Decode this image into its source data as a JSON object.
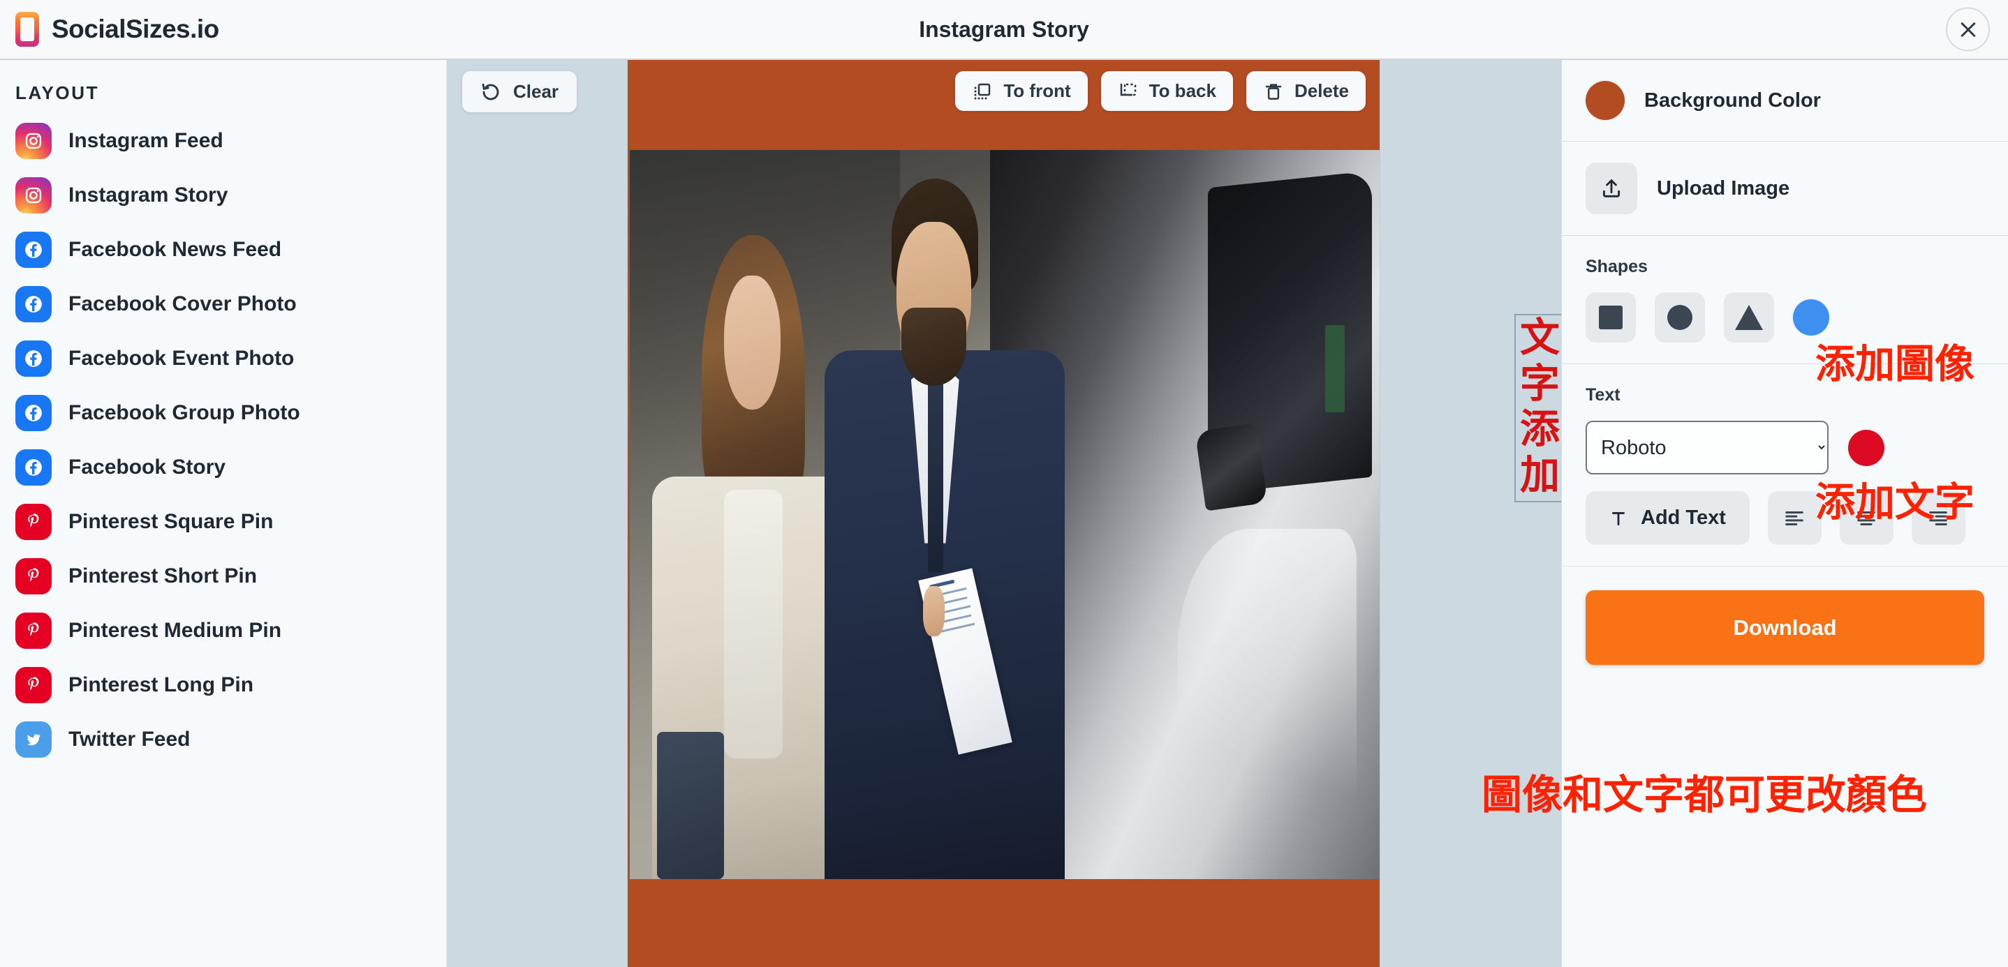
{
  "brand": {
    "name": "SocialSizes.io",
    "logo_icon": "instagram-phone-logo"
  },
  "header": {
    "title": "Instagram Story",
    "close_icon": "close-icon"
  },
  "sidebar": {
    "section_label": "LAYOUT",
    "items": [
      {
        "label": "Instagram Feed",
        "icon": "instagram-icon",
        "brand": "ig"
      },
      {
        "label": "Instagram Story",
        "icon": "instagram-icon",
        "brand": "ig"
      },
      {
        "label": "Facebook News Feed",
        "icon": "facebook-icon",
        "brand": "fb"
      },
      {
        "label": "Facebook Cover Photo",
        "icon": "facebook-icon",
        "brand": "fb"
      },
      {
        "label": "Facebook Event Photo",
        "icon": "facebook-icon",
        "brand": "fb"
      },
      {
        "label": "Facebook Group Photo",
        "icon": "facebook-icon",
        "brand": "fb"
      },
      {
        "label": "Facebook Story",
        "icon": "facebook-icon",
        "brand": "fb"
      },
      {
        "label": "Pinterest Square Pin",
        "icon": "pinterest-icon",
        "brand": "pin"
      },
      {
        "label": "Pinterest Short Pin",
        "icon": "pinterest-icon",
        "brand": "pin"
      },
      {
        "label": "Pinterest Medium Pin",
        "icon": "pinterest-icon",
        "brand": "pin"
      },
      {
        "label": "Pinterest Long Pin",
        "icon": "pinterest-icon",
        "brand": "pin"
      },
      {
        "label": "Twitter Feed",
        "icon": "twitter-icon",
        "brand": "tw"
      }
    ]
  },
  "canvas": {
    "clear_label": "Clear",
    "clear_icon": "rotate-ccw-icon",
    "to_front_label": "To front",
    "to_front_icon": "bring-to-front-icon",
    "to_back_label": "To back",
    "to_back_icon": "send-to-back-icon",
    "delete_label": "Delete",
    "delete_icon": "trash-icon",
    "background_color": "#b44c22",
    "text_object": {
      "value": "文字添加",
      "color": "#d81212",
      "selected": true
    }
  },
  "panel": {
    "background_color": {
      "label": "Background Color",
      "color": "#b44c22"
    },
    "upload": {
      "label": "Upload Image",
      "icon": "upload-icon"
    },
    "shapes": {
      "title": "Shapes",
      "items": [
        {
          "name": "square-shape",
          "icon": "square-icon"
        },
        {
          "name": "circle-shape",
          "icon": "circle-icon"
        },
        {
          "name": "triangle-shape",
          "icon": "triangle-icon"
        }
      ],
      "color": "#3d90f0"
    },
    "text": {
      "title": "Text",
      "font_value": "Roboto",
      "font_options": [
        "Roboto"
      ],
      "color": "#dd0a23",
      "add_text_label": "Add Text",
      "add_text_icon": "text-t-icon",
      "align_left_icon": "align-left-icon",
      "align_center_icon": "align-center-icon",
      "align_right_icon": "align-right-icon"
    },
    "download_label": "Download",
    "download_color": "#f97316"
  },
  "annotations": {
    "shapes": "添加圖像",
    "text": "添加文字",
    "bottom": "圖像和文字都可更改顏色",
    "color": "#ff2200"
  }
}
